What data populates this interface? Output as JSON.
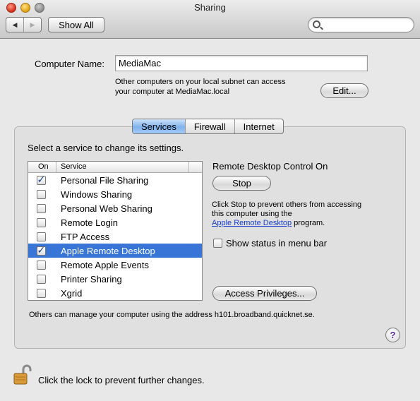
{
  "window": {
    "title": "Sharing"
  },
  "toolbar": {
    "back_glyph": "◀",
    "forward_glyph": "▶",
    "show_all_label": "Show All",
    "search_placeholder": ""
  },
  "computer_name": {
    "label": "Computer Name:",
    "value": "MediaMac",
    "note_line1": "Other computers on your local subnet can access",
    "note_line2": "your computer at MediaMac.local",
    "edit_label": "Edit..."
  },
  "tabs": [
    {
      "label": "Services",
      "active": true
    },
    {
      "label": "Firewall",
      "active": false
    },
    {
      "label": "Internet",
      "active": false
    }
  ],
  "services": {
    "instruction": "Select a service to change its settings.",
    "columns": {
      "on": "On",
      "service": "Service"
    },
    "items": [
      {
        "name": "Personal File Sharing",
        "on": true,
        "selected": false
      },
      {
        "name": "Windows Sharing",
        "on": false,
        "selected": false
      },
      {
        "name": "Personal Web Sharing",
        "on": false,
        "selected": false
      },
      {
        "name": "Remote Login",
        "on": false,
        "selected": false
      },
      {
        "name": "FTP Access",
        "on": false,
        "selected": false
      },
      {
        "name": "Apple Remote Desktop",
        "on": true,
        "selected": true
      },
      {
        "name": "Remote Apple Events",
        "on": false,
        "selected": false
      },
      {
        "name": "Printer Sharing",
        "on": false,
        "selected": false
      },
      {
        "name": "Xgrid",
        "on": false,
        "selected": false
      }
    ]
  },
  "detail": {
    "status": "Remote Desktop Control On",
    "stop_label": "Stop",
    "desc_line1": "Click Stop to prevent others from accessing",
    "desc_line2": "this computer using the",
    "desc_link": "Apple Remote Desktop",
    "desc_tail": " program.",
    "show_status_label": "Show status in menu bar",
    "show_status_checked": false,
    "access_label": "Access Privileges..."
  },
  "address_note": "Others can manage your computer using the address h101.broadband.quicknet.se.",
  "help_label": "?",
  "lock": {
    "text": "Click the lock to prevent further changes.",
    "icon": "padlock-open-icon"
  },
  "colors": {
    "selection": "#3875d7",
    "active_tab": "#7fb2ec",
    "link": "#1a3fd0"
  }
}
